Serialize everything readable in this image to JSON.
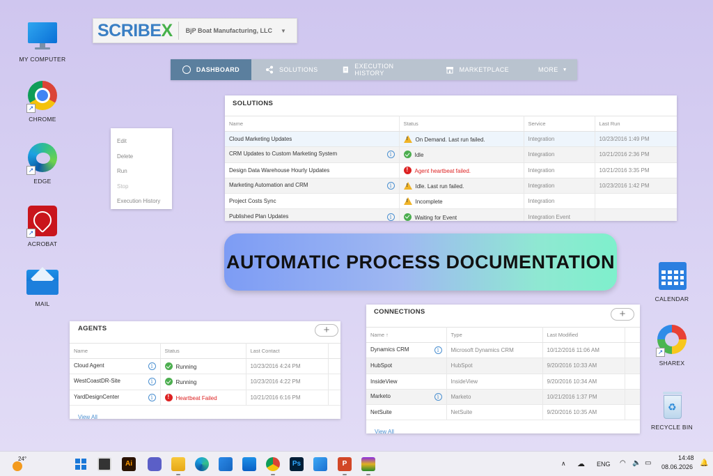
{
  "desktop": {
    "left_icons": [
      {
        "label": "MY COMPUTER",
        "icon": "monitor-icon"
      },
      {
        "label": "CHROME",
        "icon": "chrome-icon"
      },
      {
        "label": "EDGE",
        "icon": "edge-icon"
      },
      {
        "label": "ACROBAT",
        "icon": "acrobat-icon"
      },
      {
        "label": "MAIL",
        "icon": "mail-icon"
      }
    ],
    "right_icons": [
      {
        "label": "CALENDAR",
        "icon": "calendar-icon"
      },
      {
        "label": "SHAREX",
        "icon": "sharex-icon"
      },
      {
        "label": "RECYCLE BIN",
        "icon": "recycle-bin-icon"
      }
    ]
  },
  "header": {
    "logo_main": "SCRIBE",
    "logo_x": "X",
    "org_name": "BjP Boat Manufacturing, LLC",
    "caret": "▼"
  },
  "nav": {
    "items": [
      {
        "label": "DASHBOARD",
        "icon": "dashboard-gauge-icon"
      },
      {
        "label": "SOLUTIONS",
        "icon": "share-nodes-icon"
      },
      {
        "label": "EXECUTION HISTORY",
        "icon": "document-icon"
      },
      {
        "label": "MARKETPLACE",
        "icon": "store-icon"
      },
      {
        "label": "MORE",
        "icon": "caret-down-icon"
      }
    ]
  },
  "solutions": {
    "title": "SOLUTIONS",
    "columns": [
      "Name",
      "Status",
      "Service",
      "Last Run"
    ],
    "rows": [
      {
        "name": "Cloud Marketing Updates",
        "info": false,
        "status": "On Demand. Last run failed.",
        "status_type": "warn",
        "service": "Integration",
        "last_run": "10/23/2016 1:49 PM"
      },
      {
        "name": "CRM Updates to Custom Marketing System",
        "info": true,
        "status": "Idle",
        "status_type": "ok",
        "service": "Integration",
        "last_run": "10/21/2016 2:36 PM"
      },
      {
        "name": "Design Data Warehouse Hourly Updates",
        "info": false,
        "status": "Agent heartbeat failed.",
        "status_type": "err",
        "service": "Integration",
        "last_run": "10/21/2016 3:35 PM"
      },
      {
        "name": "Marketing Automation and CRM",
        "info": true,
        "status": "Idle. Last run failed.",
        "status_type": "warn",
        "service": "Integration",
        "last_run": "10/23/2016 1:42 PM"
      },
      {
        "name": "Project Costs Sync",
        "info": false,
        "status": "Incomplete",
        "status_type": "warn",
        "service": "Integration",
        "last_run": ""
      },
      {
        "name": "Published Plan Updates",
        "info": true,
        "status": "Waiting for Event",
        "status_type": "ok",
        "service": "Integration Event",
        "last_run": ""
      }
    ]
  },
  "context_menu": {
    "items": [
      {
        "label": "Edit",
        "disabled": false
      },
      {
        "label": "Delete",
        "disabled": false
      },
      {
        "label": "Run",
        "disabled": false
      },
      {
        "label": "Stop",
        "disabled": true
      },
      {
        "label": "Execution History",
        "disabled": false
      }
    ]
  },
  "banner": {
    "text": "AUTOMATIC PROCESS DOCUMENTATION"
  },
  "agents": {
    "title": "AGENTS",
    "add": "+",
    "columns": [
      "Name",
      "Status",
      "Last Contact"
    ],
    "rows": [
      {
        "name": "Cloud Agent",
        "status": "Running",
        "status_type": "ok",
        "last_contact": "10/23/2016 4:24 PM"
      },
      {
        "name": "WestCoastDR-Site",
        "status": "Running",
        "status_type": "ok",
        "last_contact": "10/23/2016 4:22 PM"
      },
      {
        "name": "YardDesignCenter",
        "status": "Heartbeat Failed",
        "status_type": "err",
        "last_contact": "10/21/2016 6:16 PM"
      }
    ],
    "view_all": "View All"
  },
  "connections": {
    "title": "CONNECTIONS",
    "add": "+",
    "columns": [
      "Name ↑",
      "Type",
      "Last Modified"
    ],
    "rows": [
      {
        "name": "Dynamics CRM",
        "info": true,
        "type": "Microsoft Dynamics CRM",
        "modified": "10/12/2016 11:06 AM"
      },
      {
        "name": "HubSpot",
        "info": false,
        "type": "HubSpot",
        "modified": "9/20/2016 10:33 AM"
      },
      {
        "name": "InsideView",
        "info": false,
        "type": "InsideView",
        "modified": "9/20/2016 10:34 AM"
      },
      {
        "name": "Marketo",
        "info": true,
        "type": "Marketo",
        "modified": "10/21/2016 1:37 PM"
      },
      {
        "name": "NetSuite",
        "info": false,
        "type": "NetSuite",
        "modified": "9/20/2016 10:35 AM"
      }
    ],
    "view_all": "View All"
  },
  "taskbar": {
    "weather": "24°",
    "language": "ENG",
    "time": "14:48",
    "date": "08.06.2026",
    "colors": {
      "accent": "#5b7f9e",
      "error": "#dd2222",
      "ok": "#4cae4f",
      "warn": "#f0b428"
    }
  }
}
